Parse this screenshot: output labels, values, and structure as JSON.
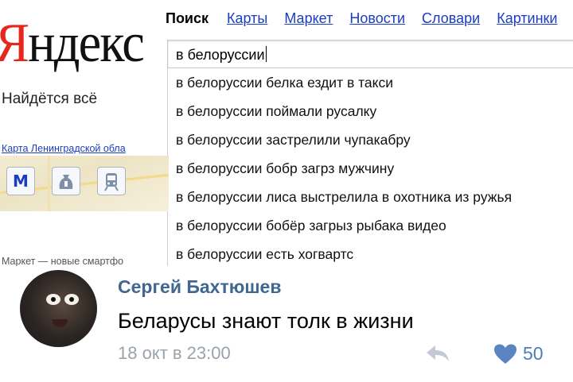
{
  "yandex": {
    "logo_first": "Я",
    "logo_rest": "ндекс",
    "slogan": "Найдётся всё",
    "nav": {
      "active": "Поиск",
      "links": [
        "Карты",
        "Маркет",
        "Новости",
        "Словари",
        "Картинки"
      ]
    },
    "search": {
      "query": "в белоруссии"
    },
    "suggestions": [
      "в белоруссии белка ездит в такси",
      "в белоруссии поймали русалку",
      "в белоруссии застрелили чупакабру",
      "в белоруссии бобр загрз мужчину",
      "в белоруссии лиса выстрелила в охотника из ружья",
      "в белоруссии бобёр загрыз рыбака видео",
      "в белоруссии есть хогвартс"
    ],
    "map_link": "Карта Ленинградской обла",
    "map_icons": [
      "metro-icon",
      "money-bag-icon",
      "train-icon"
    ],
    "metro_glyph": "M",
    "bottom_text": "Маркет — новые смартфо"
  },
  "comment": {
    "author": "Сергей Бахтюшев",
    "text": "Беларусы знают толк в жизни",
    "date": "18 окт в 23:00",
    "likes": "50"
  },
  "colors": {
    "yandex_red": "#e5281c",
    "link_blue": "#1a3dc1",
    "vk_author": "#3f6792",
    "vk_like": "#4f7bb8",
    "meta_gray": "#9aa3ad"
  }
}
